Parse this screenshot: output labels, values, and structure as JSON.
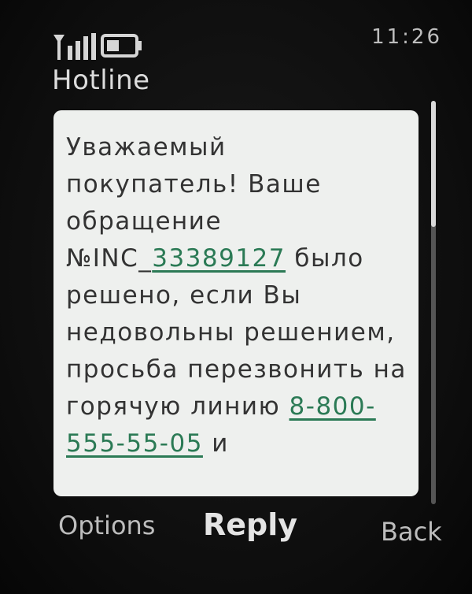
{
  "status_bar": {
    "time": "11:26",
    "signal_icon": "signal-strength-icon",
    "battery_icon": "battery-icon"
  },
  "header": {
    "title": "Hotline"
  },
  "message": {
    "text_1": "Уважаемый покупатель! Ваше обращение №INC_",
    "link_incident": "33389127",
    "text_2": " было решено, если Вы недовольны решением, просьба перезвонить на горячую линию ",
    "link_phone": "8-800-555-55-05",
    "text_3": " и"
  },
  "softkeys": {
    "left": "Options",
    "center": "Reply",
    "right": "Back"
  },
  "colors": {
    "background": "#0d0d0d",
    "message_bg": "#eef0ee",
    "message_text": "#333333",
    "link": "#2b7a55"
  }
}
